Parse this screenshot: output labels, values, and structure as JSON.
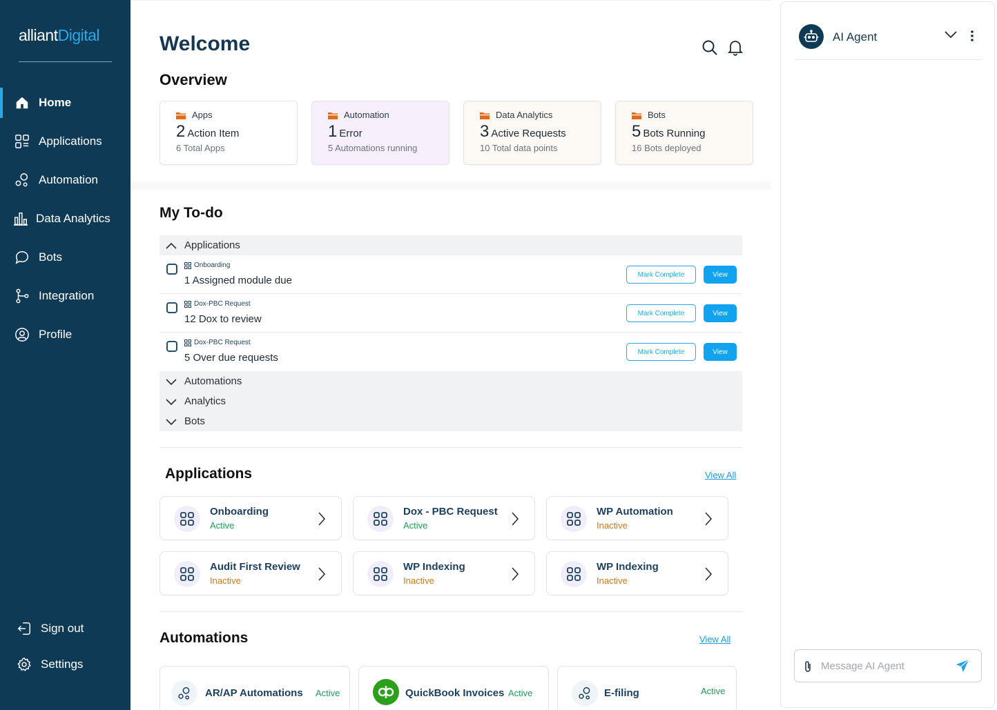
{
  "brand": {
    "part1": "alliant",
    "part2": "Digital"
  },
  "sidebar": {
    "items": [
      {
        "label": "Home",
        "icon": "home-icon"
      },
      {
        "label": "Applications",
        "icon": "grid-icon"
      },
      {
        "label": "Automation",
        "icon": "automation-icon"
      },
      {
        "label": "Data Analytics",
        "icon": "bar-chart-icon"
      },
      {
        "label": "Bots",
        "icon": "chat-bot-icon"
      },
      {
        "label": "Integration",
        "icon": "integration-icon"
      },
      {
        "label": "Profile",
        "icon": "profile-icon"
      }
    ],
    "bottom": [
      {
        "label": "Sign out",
        "icon": "sign-out-icon"
      },
      {
        "label": "Settings",
        "icon": "gear-icon"
      }
    ]
  },
  "header": {
    "title": "Welcome"
  },
  "overview": {
    "title": "Overview",
    "cards": [
      {
        "category": "Apps",
        "count": "2",
        "count_label": "Action Item",
        "sub": "6 Total Apps",
        "bg": "#ffffff"
      },
      {
        "category": "Automation",
        "count": "1",
        "count_label": "Error",
        "sub": "5 Automations running",
        "bg": "#f7effb"
      },
      {
        "category": "Data Analytics",
        "count": "3",
        "count_label": "Active Requests",
        "sub": "10 Total data points",
        "bg": "#fcf8f3"
      },
      {
        "category": "Bots",
        "count": "5",
        "count_label": "Bots Running",
        "sub": "16 Bots deployed",
        "bg": "#fcf8f3"
      }
    ]
  },
  "todo": {
    "title": "My To-do",
    "expanded_group": "Applications",
    "rows": [
      {
        "tag": "Onboarding",
        "text": "1 Assigned module due"
      },
      {
        "tag": "Dox-PBC Request",
        "text": "12 Dox to review"
      },
      {
        "tag": "Dox-PBC Request",
        "text": "5 Over due requests"
      }
    ],
    "mark_complete": "Mark Complete",
    "view": "View",
    "collapsed_groups": [
      "Automations",
      "Analytics",
      "Bots"
    ]
  },
  "applications": {
    "title": "Applications",
    "view_all": "View All",
    "items": [
      {
        "name": "Onboarding",
        "status": "Active"
      },
      {
        "name": "Dox - PBC Request",
        "status": "Active"
      },
      {
        "name": "WP Automation",
        "status": "Inactive"
      },
      {
        "name": "Audit First Review",
        "status": "Inactive"
      },
      {
        "name": "WP Indexing",
        "status": "Inactive"
      },
      {
        "name": "WP Indexing",
        "status": "Inactive"
      }
    ]
  },
  "automations": {
    "title": "Automations",
    "view_all": "View All",
    "items": [
      {
        "name": "AR/AP Automations",
        "status": "Active"
      },
      {
        "name": "QuickBook Invoices",
        "status": "Active"
      },
      {
        "name": "E-filing",
        "status": "Active"
      }
    ]
  },
  "agent": {
    "name": "AI Agent",
    "placeholder": "Message AI Agent"
  },
  "colors": {
    "sidebar": "#0f3a56",
    "accent": "#29a8e8",
    "active_status": "#1f9c5a",
    "inactive_status": "#d87415"
  }
}
